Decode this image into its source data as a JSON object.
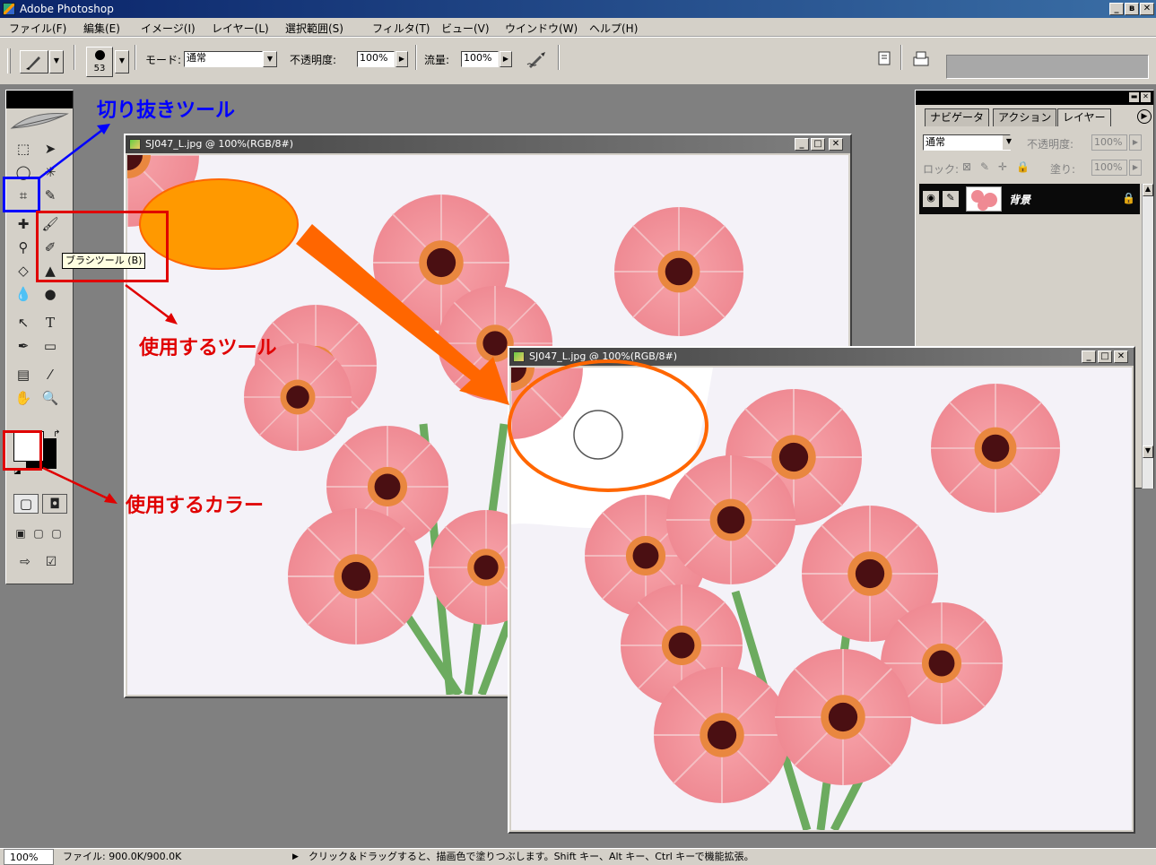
{
  "app": {
    "title": "Adobe Photoshop",
    "controls": {
      "minimize": "_",
      "restore": "ʙ",
      "close": "✕"
    }
  },
  "menu": [
    "ファイル(F)",
    "編集(E)",
    "イメージ(I)",
    "レイヤー(L)",
    "選択範囲(S)",
    "フィルタ(T)",
    "ビュー(V)",
    "ウインドウ(W)",
    "ヘルプ(H)"
  ],
  "options": {
    "brush_size": "53",
    "mode_label": "モード:",
    "mode_value": "通常",
    "opacity_label": "不透明度:",
    "opacity_value": "100%",
    "flow_label": "流量:",
    "flow_value": "100%"
  },
  "tooltip": "ブラシツール (B)",
  "documents": [
    {
      "title": "SJ047_L.jpg @ 100%(RGB/8#)",
      "controls": {
        "minimize": "_",
        "maximize": "□",
        "close": "✕"
      }
    },
    {
      "title": "SJ047_L.jpg @ 100%(RGB/8#)",
      "controls": {
        "minimize": "_",
        "maximize": "□",
        "close": "✕"
      }
    }
  ],
  "panel": {
    "tabs": [
      "ナビゲータ",
      "アクション",
      "レイヤー"
    ],
    "blend_mode": "通常",
    "opacity_label": "不透明度:",
    "opacity_value": "100%",
    "lock_label": "ロック:",
    "fill_label": "塗り:",
    "fill_value": "100%",
    "layer_name": "背景"
  },
  "status": {
    "zoom": "100%",
    "file_size": "ファイル: 900.0K/900.0K",
    "hint": "クリック＆ドラッグすると、描画色で塗りつぶします。Shift キー、Alt キー、Ctrl キーで機能拡張。"
  },
  "annotations": {
    "crop_tool": "切り抜きツール",
    "use_tool": "使用するツール",
    "use_color": "使用するカラー"
  },
  "colors": {
    "annotation_blue": "#0000ff",
    "annotation_red": "#e00000",
    "callout_orange": "#ff9900",
    "callout_outline": "#ff6600"
  }
}
